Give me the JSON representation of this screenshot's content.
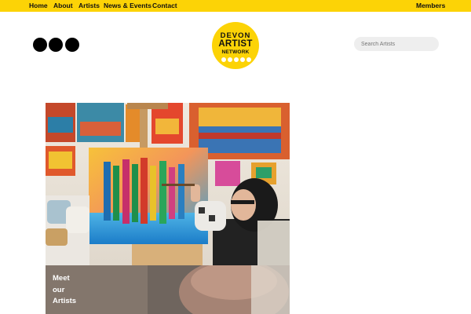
{
  "nav": {
    "items": [
      {
        "label": "Home"
      },
      {
        "label": "About"
      },
      {
        "label": "Artists"
      },
      {
        "label": "News & Events"
      },
      {
        "label": "Contact"
      }
    ],
    "members_label": "Members"
  },
  "logo": {
    "line1": "DEVON",
    "line2": "ARTIST",
    "line3": "NETWORK"
  },
  "search": {
    "placeholder": "Search Artists"
  },
  "feature": {
    "label_lines": [
      "Meet",
      "our",
      "Artists"
    ]
  },
  "colors": {
    "accent_yellow": "#fcd306",
    "text_dark": "#111111",
    "search_bg": "#eeeeee"
  },
  "icons": [
    "menu-dot-icon",
    "menu-dot-icon",
    "menu-dot-icon"
  ]
}
